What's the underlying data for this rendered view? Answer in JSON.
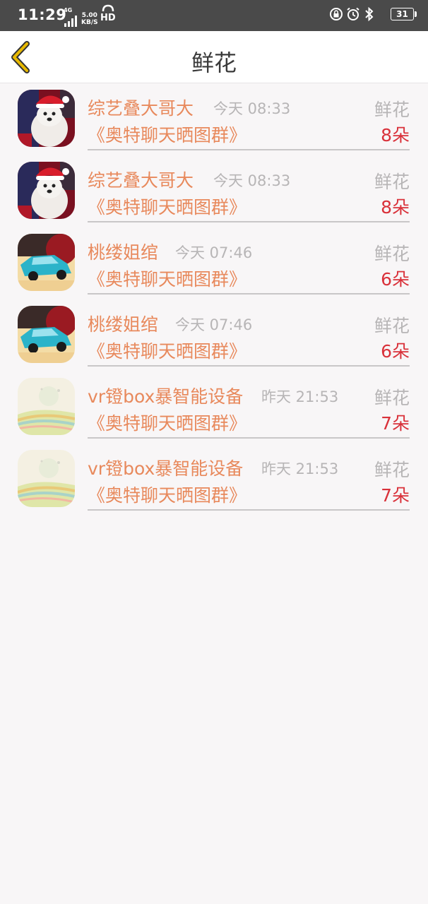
{
  "status_bar": {
    "time": "11:29",
    "network": "4G",
    "speed_value": "5.00",
    "speed_unit": "KB/S",
    "hd": "HD",
    "battery": "31"
  },
  "header": {
    "title": "鲜花"
  },
  "list": [
    {
      "name": "综艺叠大哥大",
      "time": "今天 08:33",
      "gift": "鲜花",
      "group": "《奥特聊天晒图群》",
      "count": "8朵",
      "avatar": "dog-santa"
    },
    {
      "name": "综艺叠大哥大",
      "time": "今天 08:33",
      "gift": "鲜花",
      "group": "《奥特聊天晒图群》",
      "count": "8朵",
      "avatar": "dog-santa"
    },
    {
      "name": "桃缕姐绾",
      "time": "今天 07:46",
      "gift": "鲜花",
      "group": "《奥特聊天晒图群》",
      "count": "6朵",
      "avatar": "blue-car"
    },
    {
      "name": "桃缕姐绾",
      "time": "今天 07:46",
      "gift": "鲜花",
      "group": "《奥特聊天晒图群》",
      "count": "6朵",
      "avatar": "blue-car"
    },
    {
      "name": "vr镫box暴智能设备",
      "time": "昨天 21:53",
      "gift": "鲜花",
      "group": "《奥特聊天晒图群》",
      "count": "7朵",
      "avatar": "pastel-landscape"
    },
    {
      "name": "vr镫box暴智能设备",
      "time": "昨天 21:53",
      "gift": "鲜花",
      "group": "《奥特聊天晒图群》",
      "count": "7朵",
      "avatar": "pastel-landscape"
    }
  ],
  "colors": {
    "name": "#e8895c",
    "count": "#d9313a",
    "muted": "#b7b5b6",
    "back_arrow": "#e8b900"
  }
}
